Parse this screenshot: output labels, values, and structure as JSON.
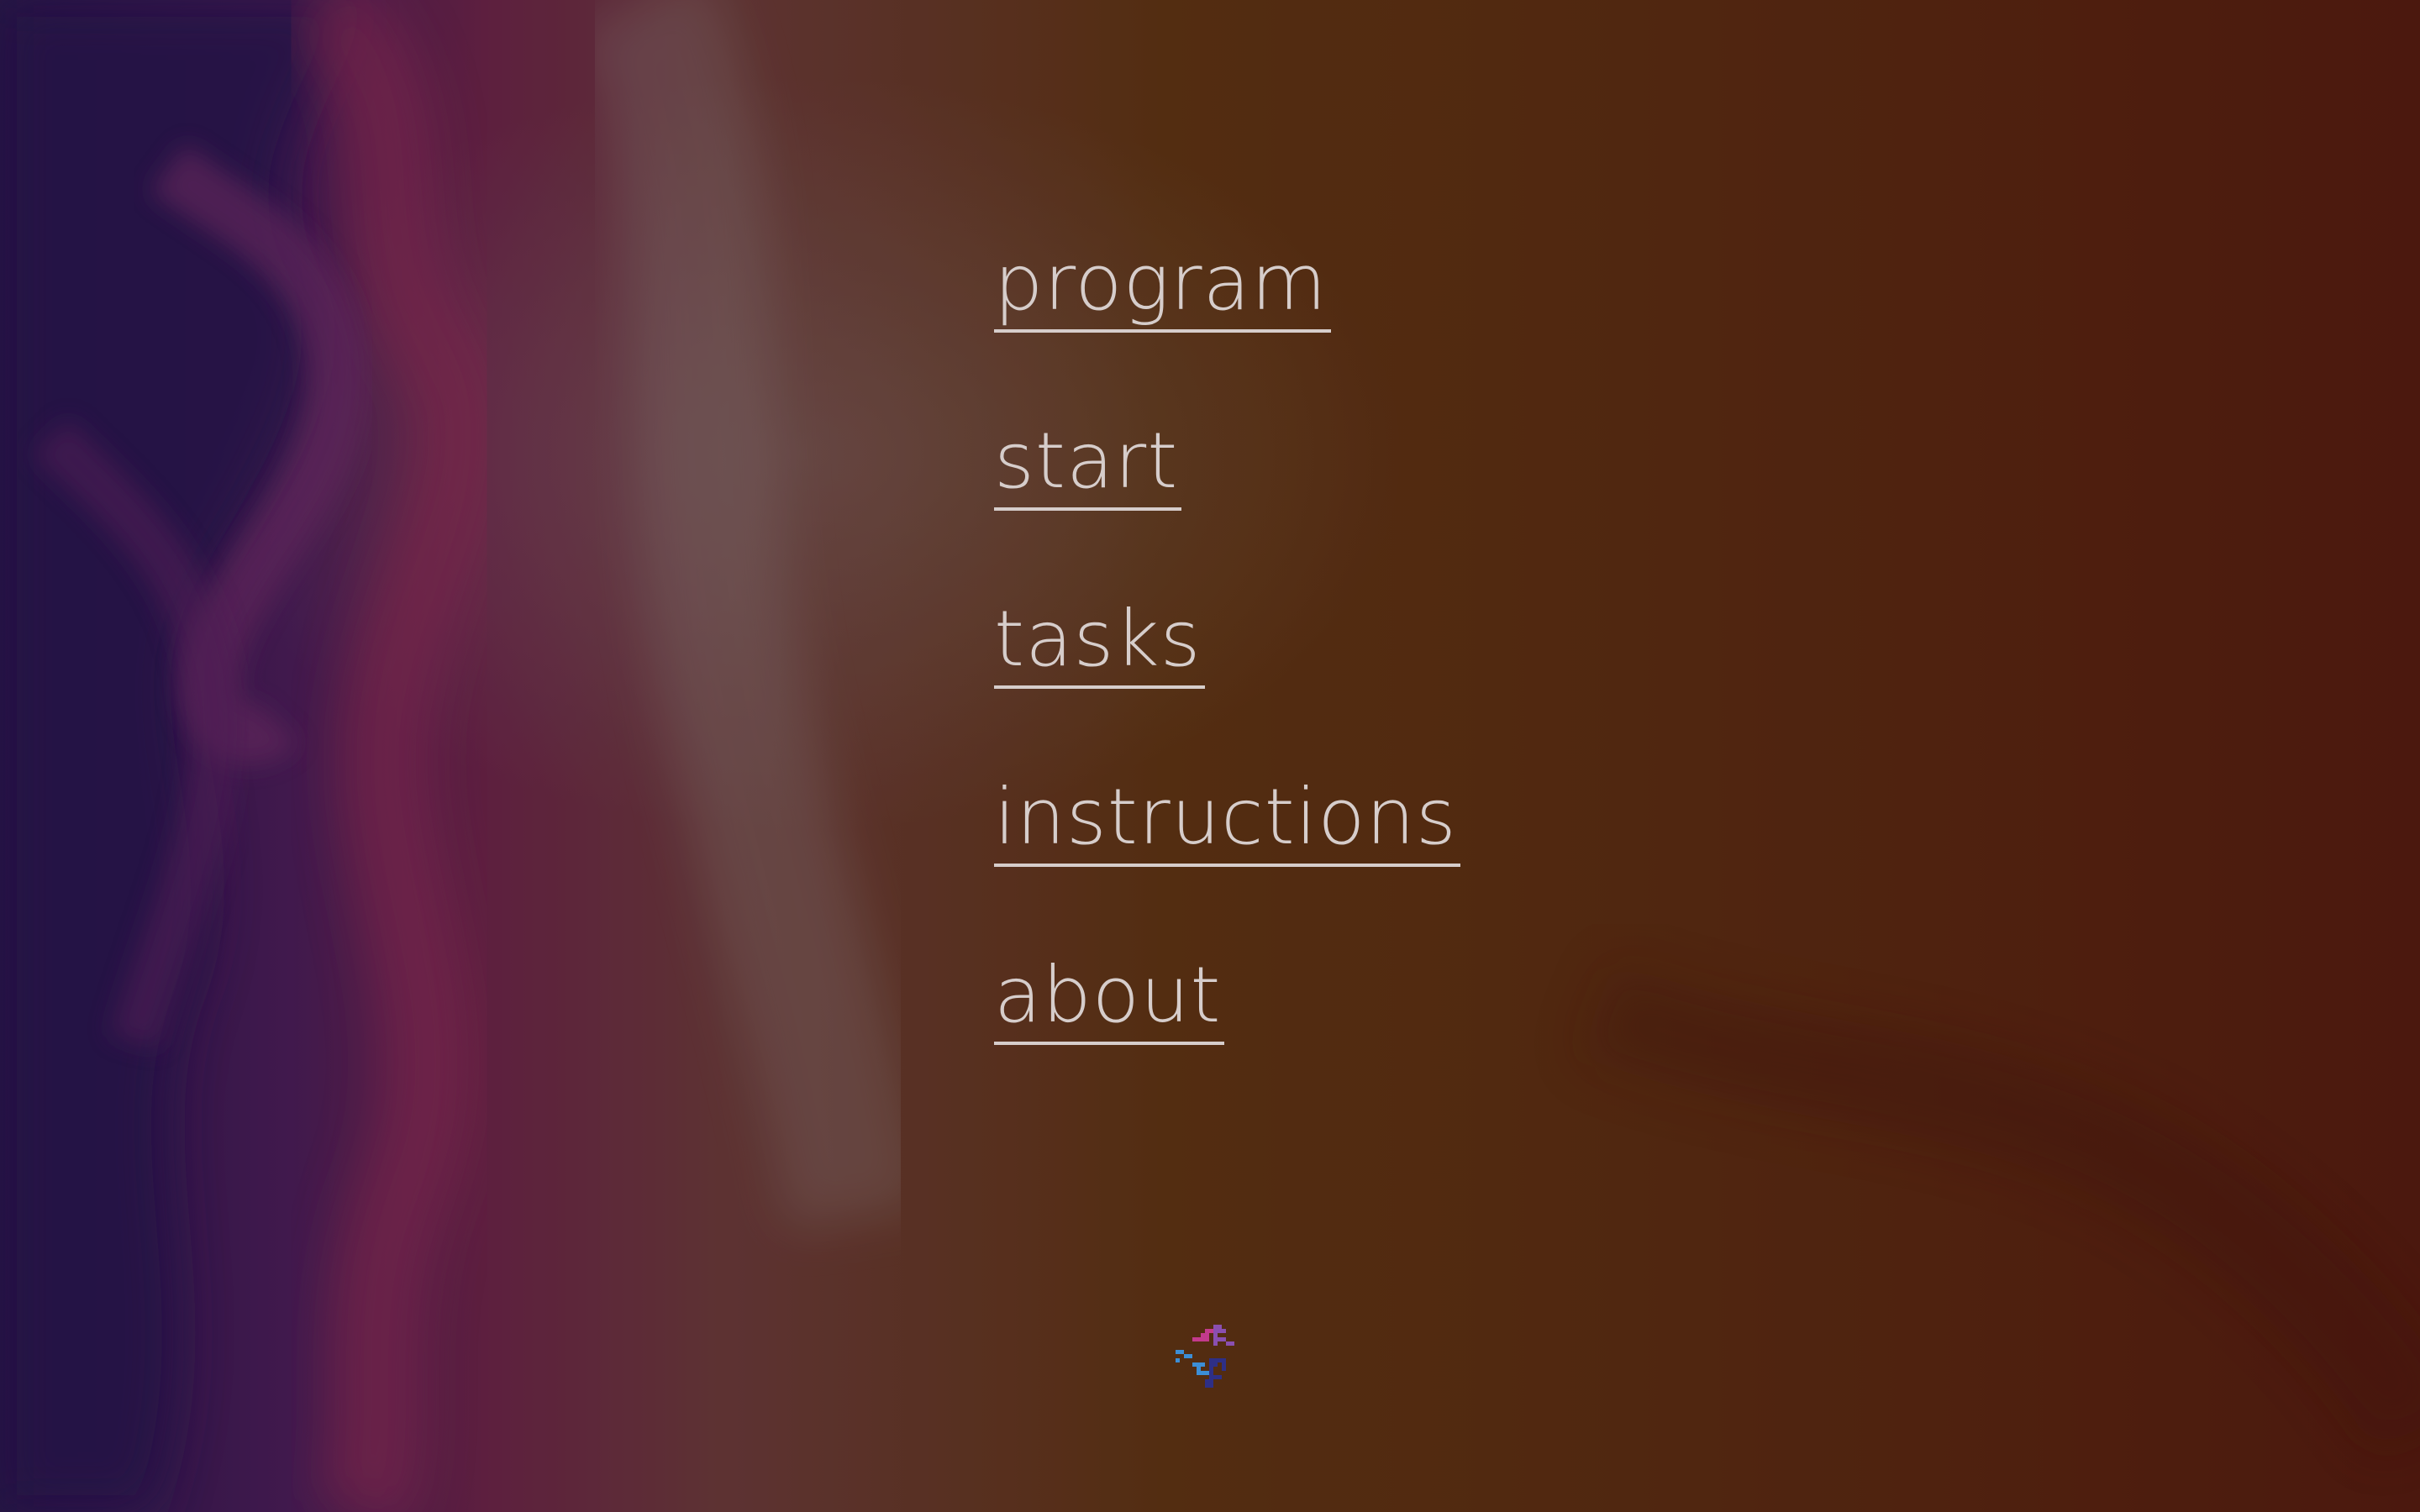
{
  "menu": {
    "items": [
      {
        "label": "program"
      },
      {
        "label": "start"
      },
      {
        "label": "tasks"
      },
      {
        "label": "instructions"
      },
      {
        "label": "about"
      }
    ]
  },
  "icons": {
    "logo": "pixel-flower-logo-icon"
  },
  "colors": {
    "menu_text": "#d6cdcb",
    "background_purple": "#2c1650",
    "background_magenta": "#6b2446",
    "background_orange": "#5d3013",
    "background_rust": "#5a1e10",
    "logo_pink": "#c33a8c",
    "logo_violet": "#8a4fb0",
    "logo_blue": "#3c8ed6",
    "logo_navy": "#2e2f86"
  }
}
